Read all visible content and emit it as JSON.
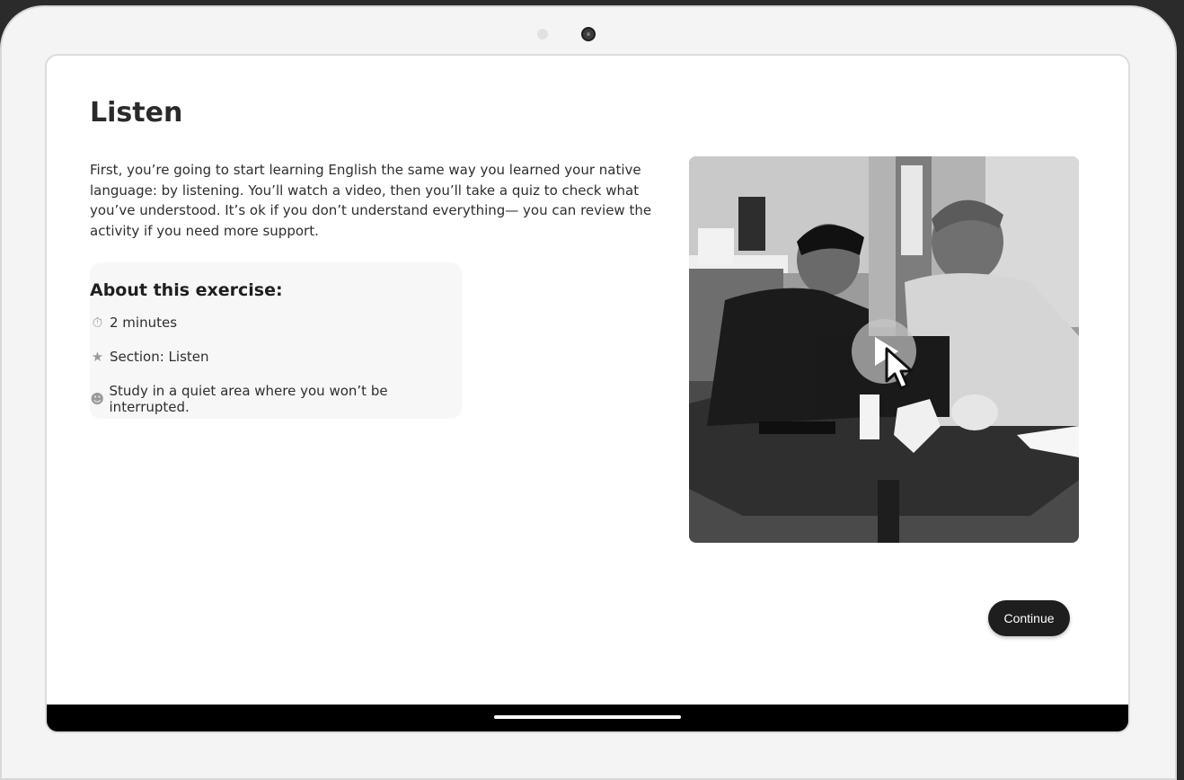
{
  "page": {
    "title": "Listen",
    "intro": "First, you’re going to start learning English the same way you learned your native language: by listening. You’ll watch a video, then you’ll take a quiz to check what you’ve understood. It’s ok if you don’t understand everything— you can review the activity if you need more support."
  },
  "about": {
    "title": "About this exercise:",
    "items": [
      {
        "icon": "stopwatch-icon",
        "glyph": "⏱",
        "text": "2 minutes"
      },
      {
        "icon": "star-icon",
        "glyph": "★",
        "text": "Section: Listen"
      },
      {
        "icon": "quiet-face-icon",
        "glyph": "☻",
        "text": "Study in a quiet area where you won’t be interrupted."
      }
    ]
  },
  "video": {
    "play_icon": "play-icon",
    "cursor_icon": "cursor-icon"
  },
  "actions": {
    "continue_label": "Continue"
  },
  "colors": {
    "button_bg": "#1e1e1e",
    "button_text": "#ffffff",
    "panel_bg": "#f7f7f7"
  }
}
